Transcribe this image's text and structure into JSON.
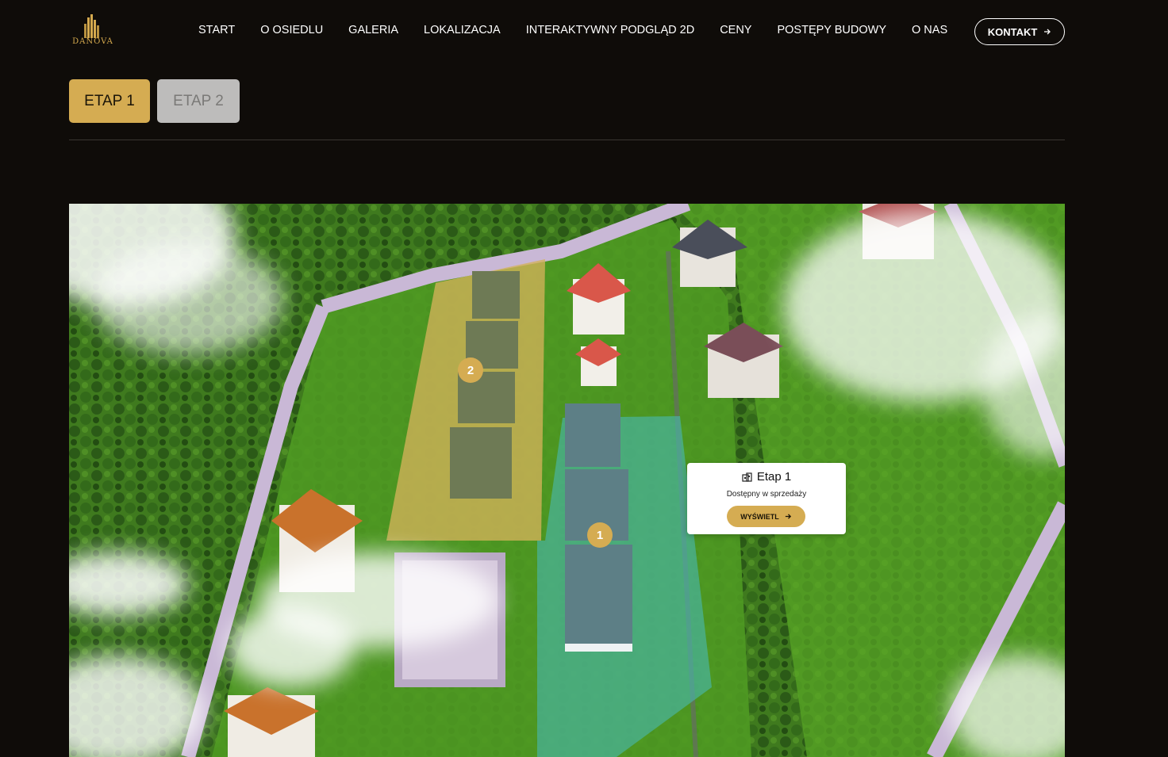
{
  "brand": {
    "logo_text": "DANOVA",
    "accent": "#d5ac52"
  },
  "nav": {
    "items": [
      "START",
      "O OSIEDLU",
      "GALERIA",
      "LOKALIZACJA",
      "INTERAKTYWNY PODGLĄD 2D",
      "CENY",
      "POSTĘPY BUDOWY",
      "O NAS"
    ],
    "contact_label": "KONTAKT"
  },
  "tabs": [
    {
      "label": "ETAP 1",
      "active": true
    },
    {
      "label": "ETAP 2",
      "active": false
    }
  ],
  "map": {
    "markers": [
      "1",
      "2"
    ],
    "popup": {
      "title": "Etap 1",
      "subtitle": "Dostępny w sprzedaży",
      "button": "WYŚWIETL",
      "icon": "building-icon"
    }
  }
}
